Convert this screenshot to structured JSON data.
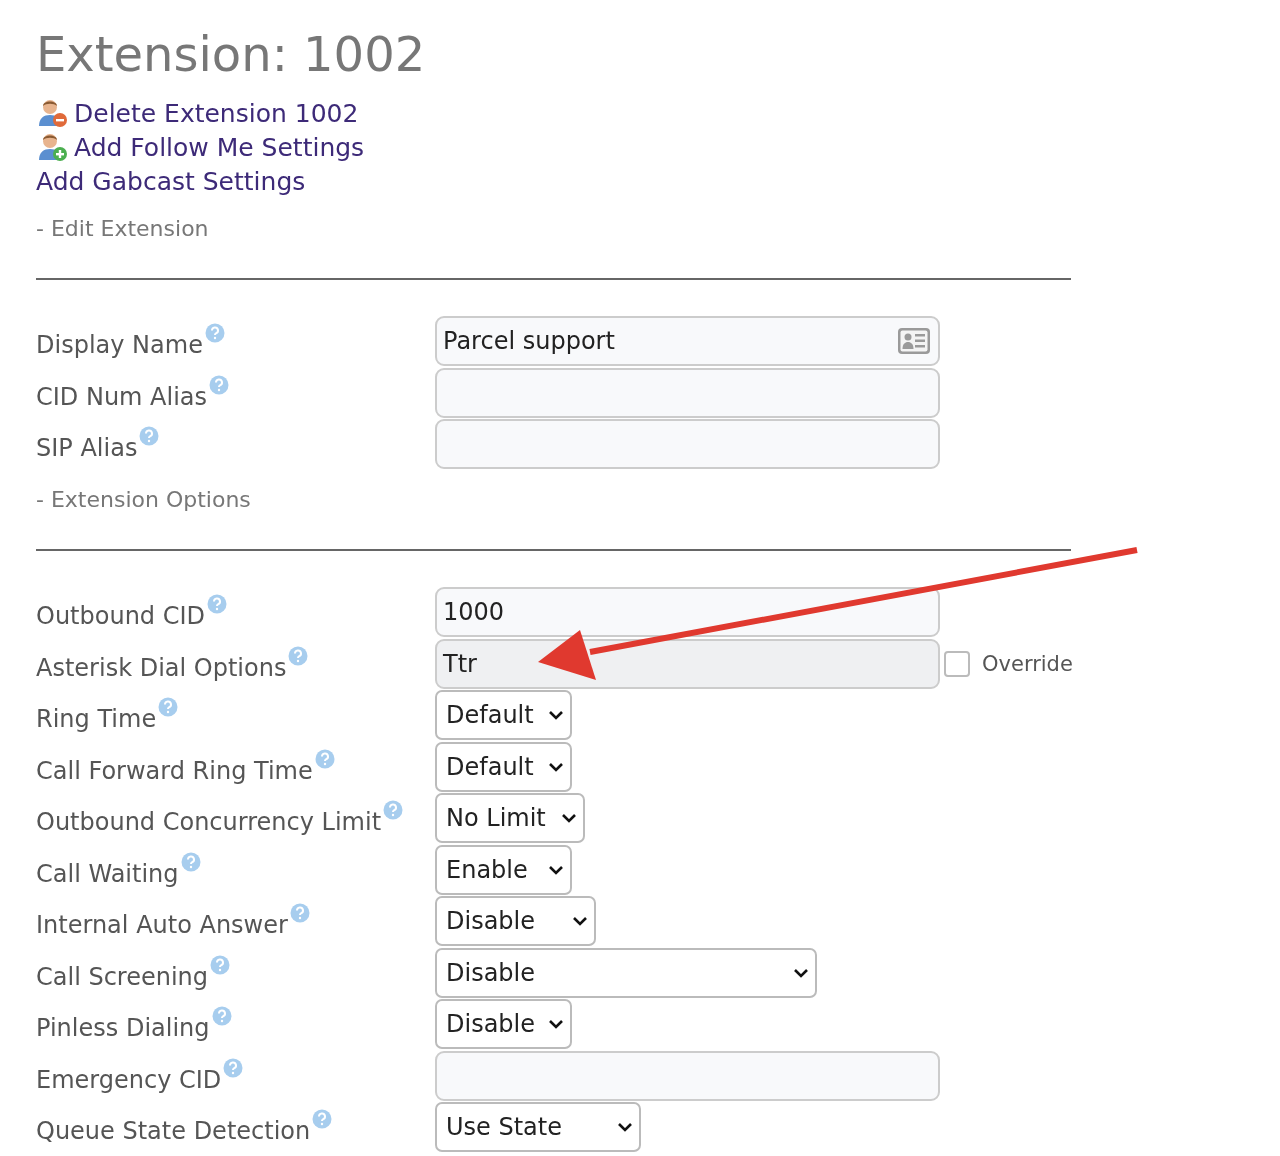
{
  "title": "Extension: 1002",
  "links": [
    {
      "label": "Delete Extension 1002"
    },
    {
      "label": "Add Follow Me Settings"
    },
    {
      "label": "Add Gabcast Settings"
    }
  ],
  "sections": [
    {
      "heading": "- Edit Extension",
      "rows": [
        {
          "label": "Display Name",
          "kind": "text",
          "value": "Parcel support"
        },
        {
          "label": "CID Num Alias",
          "kind": "text",
          "value": ""
        },
        {
          "label": "SIP Alias",
          "kind": "text",
          "value": ""
        }
      ]
    },
    {
      "heading": "- Extension Options",
      "rows": [
        {
          "label": "Outbound CID",
          "kind": "text",
          "value": "1000"
        },
        {
          "label": "Asterisk Dial Options",
          "kind": "override",
          "value": "Ttr",
          "override": {
            "label": "Override",
            "checked": false
          }
        },
        {
          "label": "Ring Time",
          "kind": "select",
          "value": "Default"
        },
        {
          "label": "Call Forward Ring Time",
          "kind": "select",
          "value": "Default"
        },
        {
          "label": "Outbound Concurrency Limit",
          "kind": "select",
          "value": "No Limit"
        },
        {
          "label": "Call Waiting",
          "kind": "select",
          "value": "Enable"
        },
        {
          "label": "Internal Auto Answer",
          "kind": "select",
          "value": "Disable"
        },
        {
          "label": "Call Screening",
          "kind": "select",
          "value": "Disable"
        },
        {
          "label": "Pinless Dialing",
          "kind": "select",
          "value": "Disable"
        },
        {
          "label": "Emergency CID",
          "kind": "text",
          "value": ""
        },
        {
          "label": "Queue State Detection",
          "kind": "select",
          "value": "Use State"
        }
      ]
    }
  ]
}
